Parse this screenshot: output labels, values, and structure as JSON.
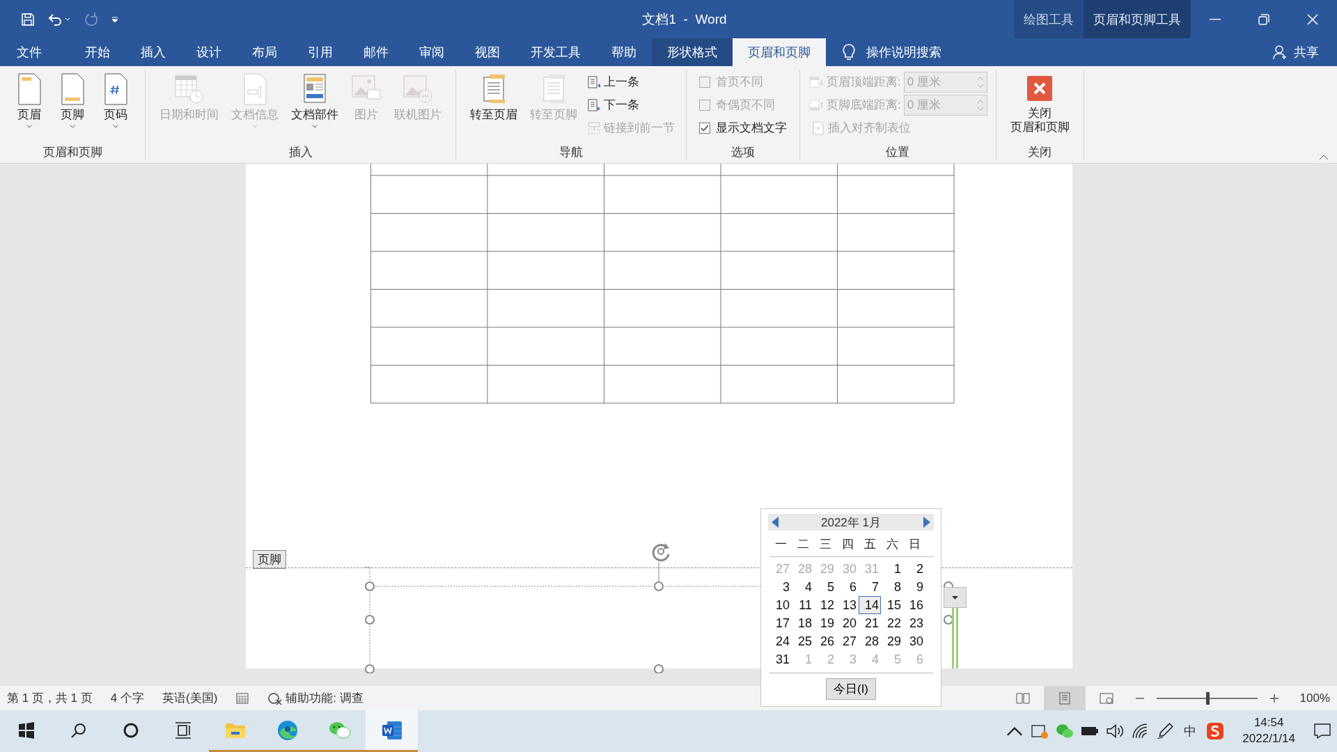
{
  "title_bar": {
    "title": "文档1  -  Word",
    "context_groups": [
      {
        "label": "绘图工具",
        "selected": false
      },
      {
        "label": "页眉和页脚工具",
        "selected": true
      }
    ]
  },
  "tabs": [
    {
      "label": "文件",
      "selected": false,
      "contextual": false
    },
    {
      "label": "开始",
      "selected": false,
      "contextual": false
    },
    {
      "label": "插入",
      "selected": false,
      "contextual": false
    },
    {
      "label": "设计",
      "selected": false,
      "contextual": false
    },
    {
      "label": "布局",
      "selected": false,
      "contextual": false
    },
    {
      "label": "引用",
      "selected": false,
      "contextual": false
    },
    {
      "label": "邮件",
      "selected": false,
      "contextual": false
    },
    {
      "label": "审阅",
      "selected": false,
      "contextual": false
    },
    {
      "label": "视图",
      "selected": false,
      "contextual": false
    },
    {
      "label": "开发工具",
      "selected": false,
      "contextual": false
    },
    {
      "label": "帮助",
      "selected": false,
      "contextual": false
    },
    {
      "label": "形状格式",
      "selected": false,
      "contextual": true
    },
    {
      "label": "页眉和页脚",
      "selected": true,
      "contextual": true
    }
  ],
  "search": {
    "label": "操作说明搜索"
  },
  "share": {
    "label": "共享"
  },
  "ribbon": {
    "groups": [
      {
        "label": "页眉和页脚",
        "items": [
          {
            "kind": "large",
            "label": "页眉",
            "disabled": false,
            "dropdown": true
          },
          {
            "kind": "large",
            "label": "页脚",
            "disabled": false,
            "dropdown": true
          },
          {
            "kind": "large",
            "label": "页码",
            "disabled": false,
            "dropdown": true
          }
        ]
      },
      {
        "label": "插入",
        "items": [
          {
            "kind": "large",
            "label": "日期和时间",
            "disabled": true,
            "dropdown": false
          },
          {
            "kind": "large",
            "label": "文档信息",
            "disabled": true,
            "dropdown": true
          },
          {
            "kind": "large",
            "label": "文档部件",
            "disabled": false,
            "dropdown": true
          },
          {
            "kind": "large",
            "label": "图片",
            "disabled": true,
            "dropdown": false
          },
          {
            "kind": "large",
            "label": "联机图片",
            "disabled": true,
            "dropdown": false
          }
        ]
      },
      {
        "label": "导航",
        "items": [
          {
            "kind": "large",
            "label": "转至页眉",
            "disabled": false,
            "dropdown": false
          },
          {
            "kind": "large",
            "label": "转至页脚",
            "disabled": true,
            "dropdown": false
          },
          {
            "kind": "small",
            "label": "上一条",
            "disabled": false
          },
          {
            "kind": "small",
            "label": "下一条",
            "disabled": false
          },
          {
            "kind": "small",
            "label": "链接到前一节",
            "disabled": true
          }
        ]
      },
      {
        "label": "选项",
        "items": [
          {
            "kind": "checkbox",
            "label": "首页不同",
            "disabled": true,
            "checked": false
          },
          {
            "kind": "checkbox",
            "label": "奇偶页不同",
            "disabled": true,
            "checked": false
          },
          {
            "kind": "checkbox",
            "label": "显示文档文字",
            "disabled": false,
            "checked": true
          }
        ]
      },
      {
        "label": "位置",
        "items": [
          {
            "kind": "spinner",
            "label": "页眉顶端距离:",
            "value": "0 厘米",
            "disabled": true
          },
          {
            "kind": "spinner",
            "label": "页脚底端距离:",
            "value": "0 厘米",
            "disabled": true
          },
          {
            "kind": "small",
            "label": "插入对齐制表位",
            "disabled": true
          }
        ]
      },
      {
        "label": "关闭",
        "items": [
          {
            "kind": "close",
            "lines": [
              "关闭",
              "页眉和页脚"
            ],
            "disabled": false
          }
        ]
      }
    ]
  },
  "document": {
    "footer_tag": "页脚"
  },
  "calendar": {
    "title": "2022年 1月",
    "weekdays": [
      "一",
      "二",
      "三",
      "四",
      "五",
      "六",
      "日"
    ],
    "days": [
      {
        "text": "27",
        "in_month": false,
        "selected": false
      },
      {
        "text": "28",
        "in_month": false,
        "selected": false
      },
      {
        "text": "29",
        "in_month": false,
        "selected": false
      },
      {
        "text": "30",
        "in_month": false,
        "selected": false
      },
      {
        "text": "31",
        "in_month": false,
        "selected": false
      },
      {
        "text": "1",
        "in_month": true,
        "selected": false
      },
      {
        "text": "2",
        "in_month": true,
        "selected": false
      },
      {
        "text": "3",
        "in_month": true,
        "selected": false
      },
      {
        "text": "4",
        "in_month": true,
        "selected": false
      },
      {
        "text": "5",
        "in_month": true,
        "selected": false
      },
      {
        "text": "6",
        "in_month": true,
        "selected": false
      },
      {
        "text": "7",
        "in_month": true,
        "selected": false
      },
      {
        "text": "8",
        "in_month": true,
        "selected": false
      },
      {
        "text": "9",
        "in_month": true,
        "selected": false
      },
      {
        "text": "10",
        "in_month": true,
        "selected": false
      },
      {
        "text": "11",
        "in_month": true,
        "selected": false
      },
      {
        "text": "12",
        "in_month": true,
        "selected": false
      },
      {
        "text": "13",
        "in_month": true,
        "selected": false
      },
      {
        "text": "14",
        "in_month": true,
        "selected": true
      },
      {
        "text": "15",
        "in_month": true,
        "selected": false
      },
      {
        "text": "16",
        "in_month": true,
        "selected": false
      },
      {
        "text": "17",
        "in_month": true,
        "selected": false
      },
      {
        "text": "18",
        "in_month": true,
        "selected": false
      },
      {
        "text": "19",
        "in_month": true,
        "selected": false
      },
      {
        "text": "20",
        "in_month": true,
        "selected": false
      },
      {
        "text": "21",
        "in_month": true,
        "selected": false
      },
      {
        "text": "22",
        "in_month": true,
        "selected": false
      },
      {
        "text": "23",
        "in_month": true,
        "selected": false
      },
      {
        "text": "24",
        "in_month": true,
        "selected": false
      },
      {
        "text": "25",
        "in_month": true,
        "selected": false
      },
      {
        "text": "26",
        "in_month": true,
        "selected": false
      },
      {
        "text": "27",
        "in_month": true,
        "selected": false
      },
      {
        "text": "28",
        "in_month": true,
        "selected": false
      },
      {
        "text": "29",
        "in_month": true,
        "selected": false
      },
      {
        "text": "30",
        "in_month": true,
        "selected": false
      },
      {
        "text": "31",
        "in_month": true,
        "selected": false
      },
      {
        "text": "1",
        "in_month": false,
        "selected": false
      },
      {
        "text": "2",
        "in_month": false,
        "selected": false
      },
      {
        "text": "3",
        "in_month": false,
        "selected": false
      },
      {
        "text": "4",
        "in_month": false,
        "selected": false
      },
      {
        "text": "5",
        "in_month": false,
        "selected": false
      },
      {
        "text": "6",
        "in_month": false,
        "selected": false
      }
    ],
    "today_button": "今日(I)"
  },
  "status_bar": {
    "page_info": "第 1 页，共 1 页",
    "word_count": "4 个字",
    "language": "英语(美国)",
    "accessibility": "辅助功能: 调查",
    "views": [
      {
        "selected": false
      },
      {
        "selected": true
      },
      {
        "selected": false
      }
    ],
    "zoom": {
      "level": 0.5,
      "reading": "100%"
    }
  },
  "taskbar": {
    "apps": [
      {
        "running": true,
        "selected": false
      },
      {
        "running": true,
        "selected": false
      },
      {
        "running": true,
        "selected": false
      },
      {
        "running": true,
        "selected": true
      }
    ],
    "input_method": "中",
    "time": "14:54",
    "date": "2022/1/14"
  }
}
